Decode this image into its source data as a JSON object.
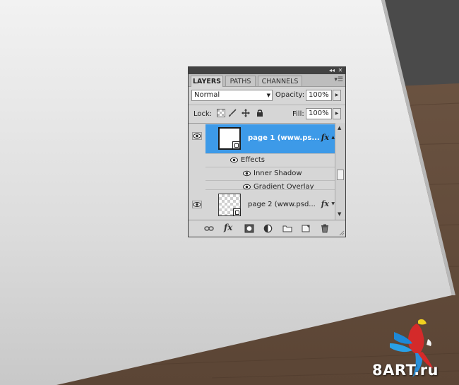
{
  "panel": {
    "tabs": [
      {
        "label": "LAYERS",
        "active": true
      },
      {
        "label": "PATHS",
        "active": false
      },
      {
        "label": "CHANNELS",
        "active": false
      }
    ],
    "blend_mode": "Normal",
    "opacity_label": "Opacity:",
    "opacity_value": "100%",
    "lock_label": "Lock:",
    "fill_label": "Fill:",
    "fill_value": "100%"
  },
  "layers": [
    {
      "name": "page 1 (www.ps...",
      "selected": true,
      "fx": "fx",
      "effects_label": "Effects",
      "effects": [
        "Inner Shadow",
        "Gradient Overlay"
      ]
    },
    {
      "name": "page 2 (www.psd...",
      "selected": false,
      "fx": "fx"
    }
  ],
  "toolbar": {
    "fx_label": "fx"
  },
  "watermark": {
    "text": "8ART.ru"
  },
  "colors": {
    "selection": "#3d9ae8",
    "panel_bg": "#d6d6d6",
    "title_bar": "#424242"
  }
}
